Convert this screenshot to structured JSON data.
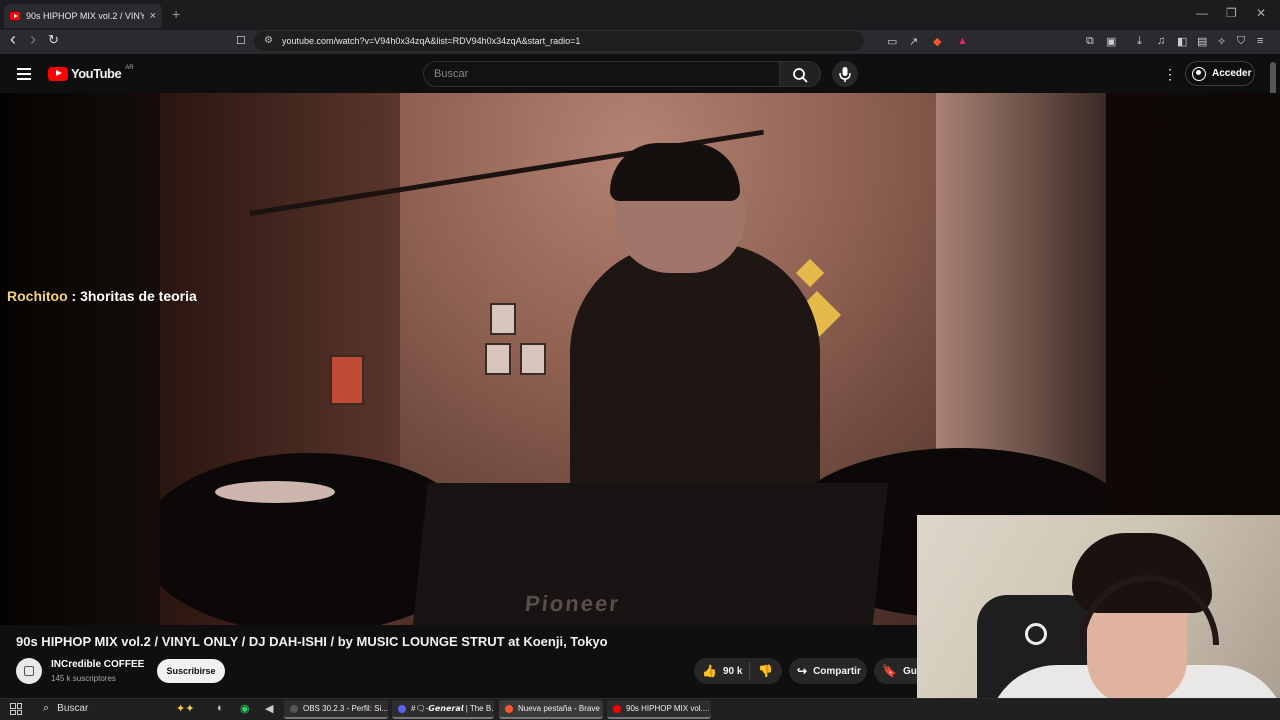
{
  "browser": {
    "tab_title": "90s HIPHOP MIX vol.2 / VINY",
    "tab_close": "×",
    "new_tab": "+",
    "url": "youtube.com/watch?v=V94h0x34zqA&list=RDV94h0x34zqA&start_radio=1",
    "window_controls": [
      "—",
      "❐",
      "✕"
    ]
  },
  "youtube": {
    "logo_text": "YouTube",
    "country_code": "AR",
    "search_placeholder": "Buscar",
    "signin_label": "Acceder",
    "more_icon": "⋮"
  },
  "video": {
    "overlay_user": "Rochitoo",
    "overlay_message": " : 3horitas de teoria",
    "mixer_brand": "Pioneer",
    "title": "90s HIPHOP MIX vol.2 / VINYL ONLY / DJ DAH-ISHI / by MUSIC LOUNGE STRUT at Koenji, Tokyo",
    "channel_name": "INCredible COFFEE",
    "subscribers": "145 k suscriptores",
    "subscribe_label": "Suscribirse",
    "likes": "90 k",
    "share_label": "Compartir",
    "save_label": "Guardar"
  },
  "taskbar": {
    "search_label": "Buscar",
    "apps": [
      {
        "label": "OBS 30.2.3 - Perfil: Si...",
        "color": "#3a3a3a"
      },
      {
        "label": "#🗨-𝙂𝙚𝙣𝙚𝙧𝙖𝙡 | The B...",
        "color": "#5865f2"
      },
      {
        "label": "Nueva pestaña - Brave",
        "color": "#fb542b"
      },
      {
        "label": "90s HIPHOP MIX vol....",
        "color": "#ff0000"
      }
    ]
  },
  "icons": {
    "back": "‹",
    "forward": "›",
    "reload": "↻",
    "bookmark": "☐",
    "site_info": "⚙",
    "like": "👍",
    "dislike": "👎",
    "share": "↪",
    "save": "🔖",
    "search": "⌕"
  }
}
